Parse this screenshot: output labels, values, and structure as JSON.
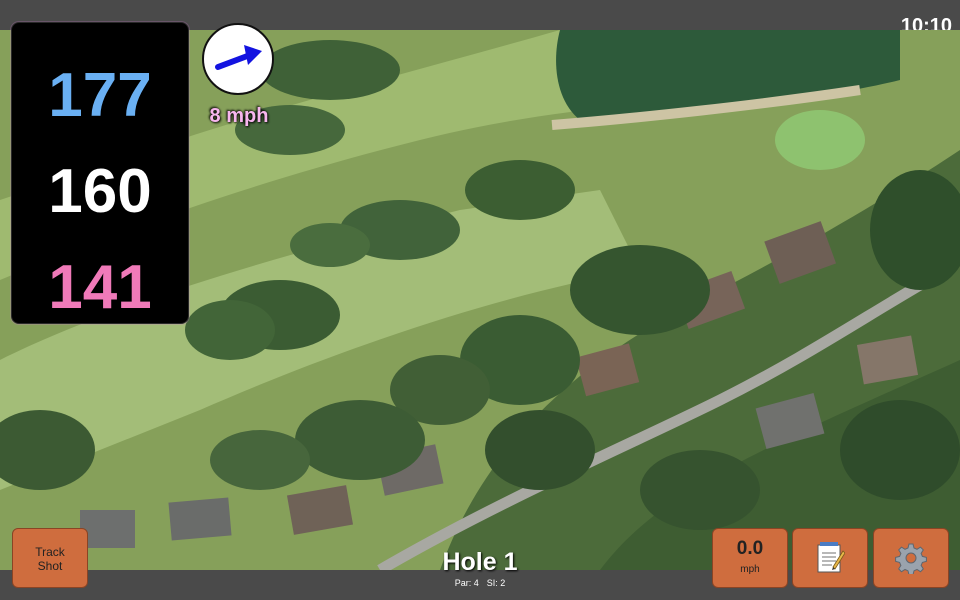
{
  "status": {
    "time": "10:10"
  },
  "distances": {
    "back": "177",
    "center": "160",
    "front": "141"
  },
  "wind": {
    "speed": "8 mph",
    "direction_icon": "arrow-up-right-icon"
  },
  "hole": {
    "title": "Hole 1",
    "par": "Par: 4",
    "si": "SI: 2"
  },
  "buttons": {
    "track_shot": "Track\nShot",
    "speed_value": "0.0",
    "speed_unit": "mph",
    "notes_icon": "notepad-icon",
    "settings_icon": "gear-icon"
  },
  "colors": {
    "back_distance": "#6ab0f3",
    "center_distance": "#ffffff",
    "front_distance": "#f07ab9",
    "button": "#cf6d3e",
    "wind_text": "#f7b6ee"
  }
}
